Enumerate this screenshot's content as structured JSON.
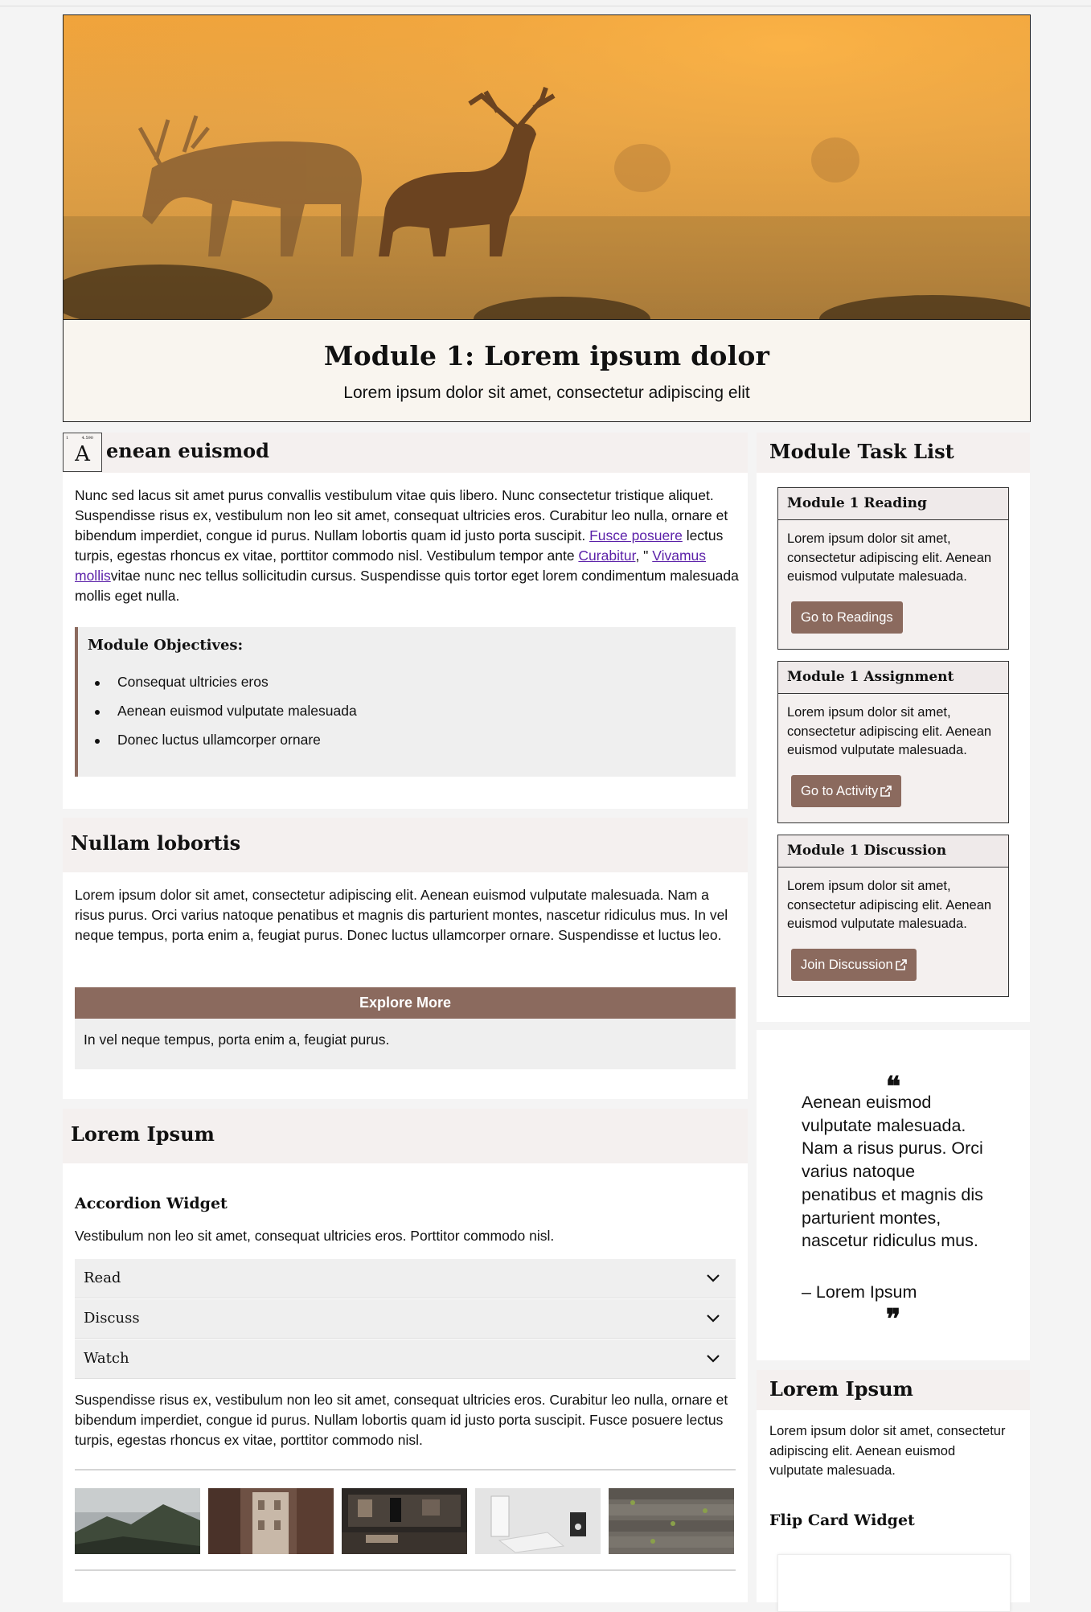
{
  "banner": {
    "title": "Module 1: Lorem ipsum dolor",
    "subtitle": "Lorem ipsum dolor sit amet, consectetur adipiscing elit"
  },
  "section1": {
    "dropcap": "A",
    "dropcap_note_left": "1",
    "dropcap_note_right": "4.590",
    "title": "enean euismod",
    "para_a": "Nunc sed lacus sit amet purus convallis vestibulum vitae quis libero. Nunc consectetur tristique aliquet. Suspendisse risus ex, vestibulum non leo sit amet, consequat ultricies eros. Curabitur leo nulla, ornare et bibendum imperdiet, congue id purus. Nullam lobortis quam id justo porta suscipit. ",
    "link1": "Fusce posuere",
    "para_b": " lectus turpis, egestas rhoncus ex vitae, porttitor commodo nisl. Vestibulum tempor ante ",
    "link2": "Curabitur",
    "para_c": ", \" ",
    "link3": "Vivamus mollis",
    "para_d": "vitae nunc nec tellus sollicitudin cursus. Suspendisse quis tortor eget lorem condimentum malesuada mollis eget nulla.",
    "objectives_title": "Module Objectives:",
    "objectives": [
      "Consequat ultricies eros",
      "Aenean euismod vulputate malesuada",
      "Donec luctus ullamcorper ornare"
    ]
  },
  "section2": {
    "title": "Nullam lobortis",
    "text": "Lorem ipsum dolor sit amet, consectetur adipiscing elit. Aenean euismod vulputate malesuada. Nam a risus purus. Orci varius natoque penatibus et magnis dis parturient montes, nascetur ridiculus mus. In vel neque tempus, porta enim a, feugiat purus. Donec luctus ullamcorper ornare. Suspendisse et luctus leo.",
    "explore_label": "Explore More",
    "explore_text": "In vel neque tempus, porta enim a, feugiat purus."
  },
  "section3": {
    "title": "Lorem Ipsum",
    "accordion_title": "Accordion Widget",
    "accordion_desc": "Vestibulum non leo sit amet, consequat ultricies eros. Porttitor commodo nisl.",
    "accordion_items": [
      "Read",
      "Discuss",
      "Watch"
    ],
    "paragraph": "Suspendisse risus ex, vestibulum non leo sit amet, consequat ultricies eros. Curabitur leo nulla, ornare et bibendum imperdiet, congue id purus. Nullam lobortis quam id justo porta suscipit. Fusce posuere lectus turpis, egestas rhoncus ex vitae, porttitor commodo nisl."
  },
  "tasks": {
    "title": "Module Task List",
    "cards": [
      {
        "title": "Module 1 Reading",
        "text": "Lorem ipsum dolor sit amet, consectetur adipiscing elit. Aenean euismod vulputate malesuada.",
        "button": "Go to Readings",
        "external": false
      },
      {
        "title": "Module 1 Assignment",
        "text": "Lorem ipsum dolor sit amet, consectetur adipiscing elit. Aenean euismod vulputate malesuada.",
        "button": "Go to Activity",
        "external": true
      },
      {
        "title": "Module 1 Discussion",
        "text": "Lorem ipsum dolor sit amet, consectetur adipiscing elit. Aenean euismod vulputate malesuada.",
        "button": "Join Discussion",
        "external": true
      }
    ]
  },
  "quote": {
    "open": "❝",
    "text": "Aenean euismod vulputate malesuada. Nam a risus purus. Orci varius natoque penatibus et magnis dis parturient montes, nascetur ridiculus mus.",
    "author": "– Lorem Ipsum",
    "close": "❞"
  },
  "sidebar_section": {
    "title": "Lorem Ipsum",
    "text": "Lorem ipsum dolor sit amet, consectetur adipiscing elit. Aenean euismod vulputate malesuada.",
    "flip_title": "Flip Card Widget"
  },
  "colors": {
    "accent_brown": "#8b6a5e",
    "header_bg": "#f4f0ef",
    "link_purple": "#5a1fa8"
  },
  "icons": [
    "chevron-down-icon",
    "external-link-icon",
    "quote-open-icon",
    "quote-close-icon"
  ]
}
